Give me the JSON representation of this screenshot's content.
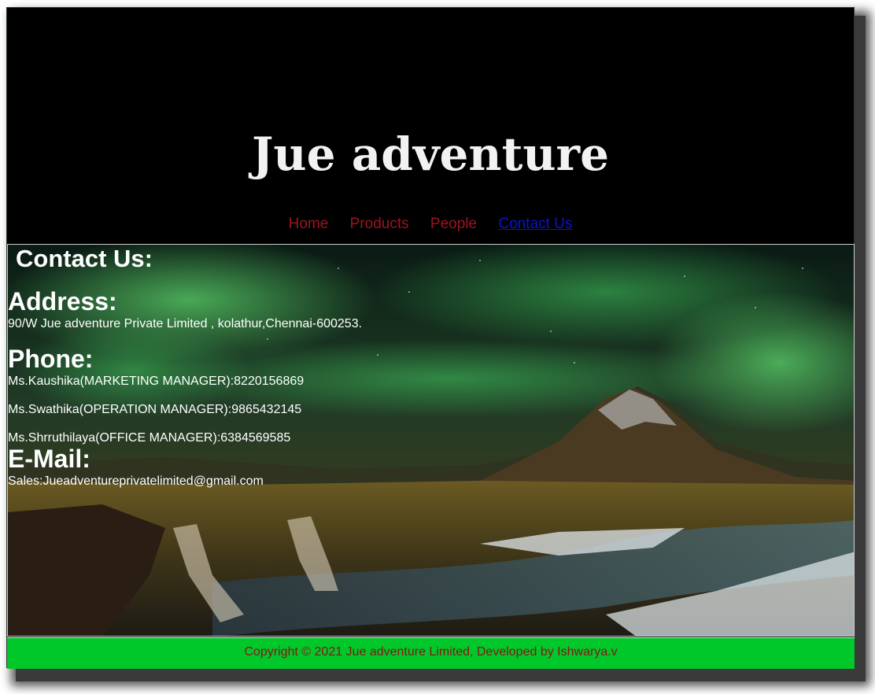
{
  "site": {
    "title": "Jue adventure"
  },
  "nav": {
    "items": [
      {
        "label": "Home",
        "active": false
      },
      {
        "label": "Products",
        "active": false
      },
      {
        "label": "People",
        "active": false
      },
      {
        "label": "Contact Us",
        "active": true
      }
    ]
  },
  "contact": {
    "heading": "Contact Us:",
    "address": {
      "title": "Address:",
      "text": "90/W Jue adventure Private Limited , kolathur,Chennai-600253."
    },
    "phone": {
      "title": "Phone:",
      "entries": [
        "Ms.Kaushika(MARKETING MANAGER):8220156869",
        "Ms.Swathika(OPERATION MANAGER):9865432145",
        "Ms.Shrruthilaya(OFFICE MANAGER):6384569585"
      ]
    },
    "email": {
      "title": "E-Mail:",
      "text": "Sales:Jueadventureprivatelimited@gmail.com"
    }
  },
  "footer": {
    "text": "Copyright © 2021 Jue adventure Limited, Developed by Ishwarya.v"
  },
  "colors": {
    "page_bg": "#000000",
    "title_text": "#f2f2f2",
    "nav_link": "#9b1420",
    "nav_active": "#0a14c8",
    "footer_bg": "#00c82a",
    "footer_text": "#8a1414"
  },
  "background_image": "aurora-mountain-waterfall-landscape"
}
